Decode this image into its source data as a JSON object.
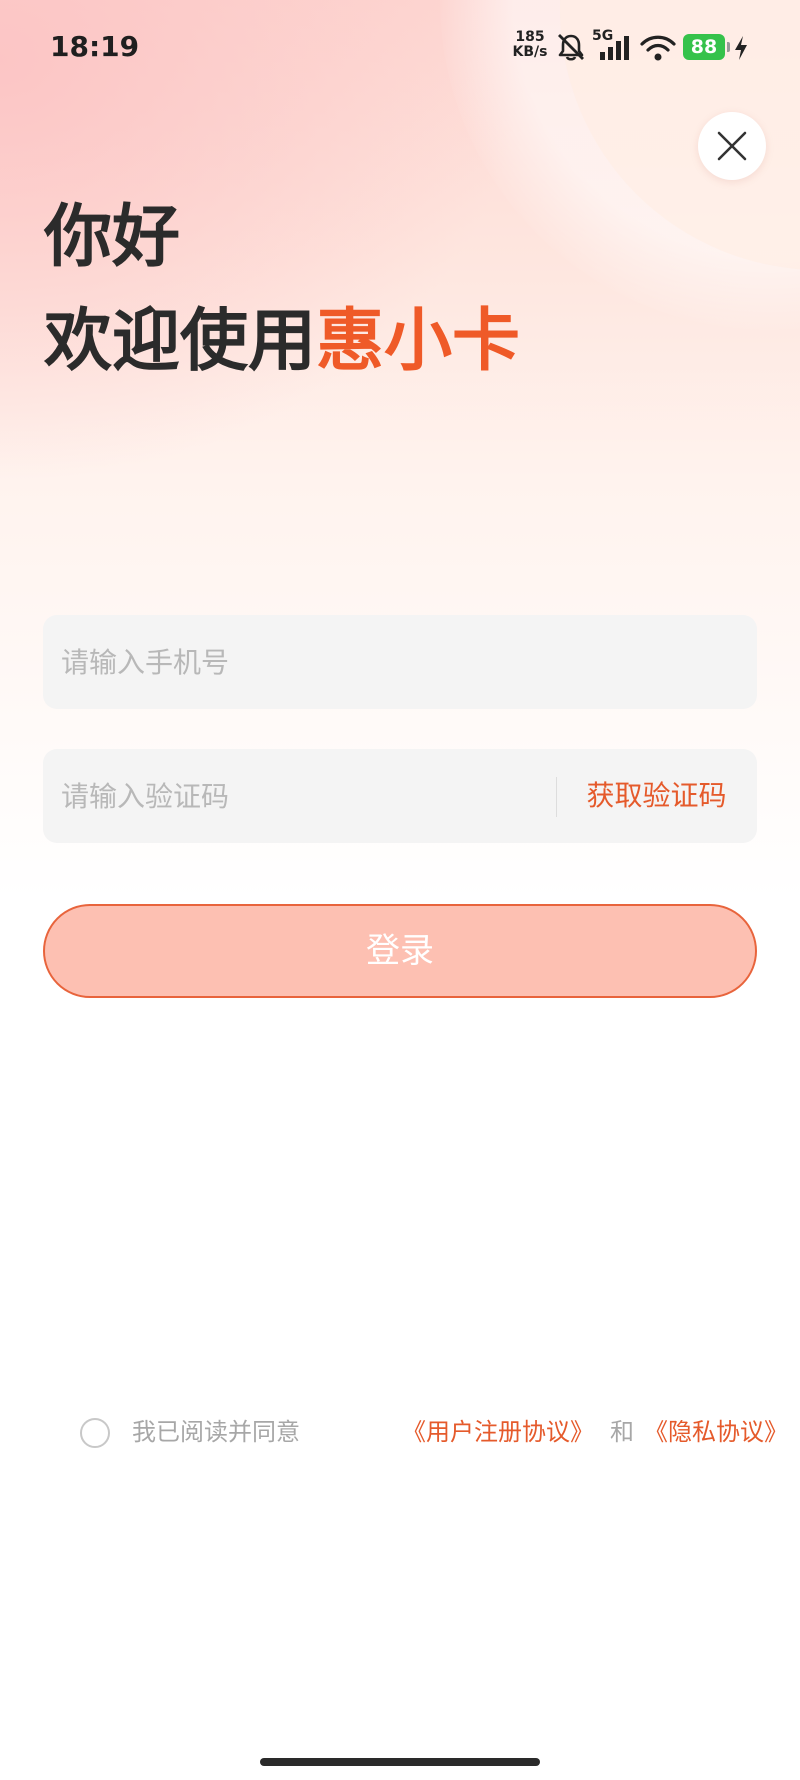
{
  "status_bar": {
    "time": "18:19",
    "net_speed_value": "185",
    "net_speed_unit": "KB/s",
    "network_type": "5G",
    "battery": "88",
    "icons": [
      "bell-off-icon",
      "cellular-signal-icon",
      "wifi-icon",
      "battery-icon",
      "charging-bolt-icon"
    ]
  },
  "header": {
    "greeting": "你好",
    "welcome_prefix": "欢迎使用",
    "brand_name": "惠小卡",
    "close_icon": "close-icon"
  },
  "form": {
    "phone_placeholder": "请输入手机号",
    "phone_value": "",
    "code_placeholder": "请输入验证码",
    "code_value": "",
    "get_code_label": "获取验证码",
    "login_label": "登录"
  },
  "agreement": {
    "checked": false,
    "prefix": "我已阅读并同意",
    "user_agreement": "《用户注册协议》",
    "conjunction": "和",
    "privacy_policy": "《隐私协议》"
  },
  "colors": {
    "accent": "#ef5a28",
    "link": "#e55a2b",
    "button_fill": "#fdc0b2",
    "button_border": "#e8643c",
    "battery": "#35c24b"
  }
}
